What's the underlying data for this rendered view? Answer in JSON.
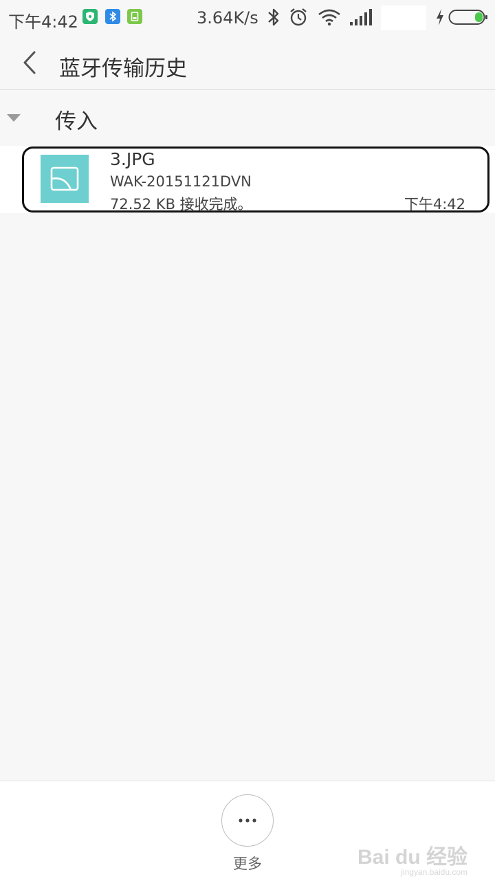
{
  "status_bar": {
    "time": "下午4:42",
    "speed": "3.64K/s"
  },
  "header": {
    "title": "蓝牙传输历史"
  },
  "section": {
    "label": "传入"
  },
  "transfers": [
    {
      "name": "3.JPG",
      "device": "WAK-20151121DVN",
      "status": "72.52 KB 接收完成。",
      "time": "下午4:42"
    }
  ],
  "bottom_bar": {
    "more_label": "更多"
  },
  "watermark": {
    "text": "Bai du 经验",
    "sub": "jingyan.baidu.com"
  },
  "colors": {
    "thumb": "#6dcfcf",
    "battery": "#4cc94c",
    "shield_badge": "#2bb673",
    "bt_badge": "#2f8be6",
    "sd_badge": "#7cc84a"
  }
}
